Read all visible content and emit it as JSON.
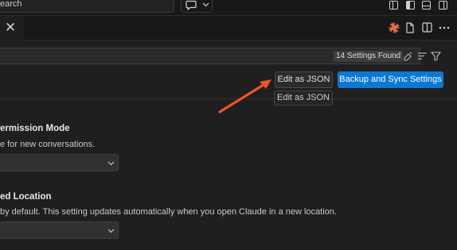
{
  "titlebar": {
    "search_text": "earch",
    "chat_icon": "comment-sparkle-icon",
    "layout_icons": [
      "layout-editor-icon",
      "toggle-sidebar-icon",
      "toggle-panel-icon",
      "toggle-secondary-sidebar-icon"
    ]
  },
  "tabbar": {
    "close_glyph": "✕",
    "actions": [
      "claude-asterisk-icon",
      "open-file-icon",
      "split-editor-icon",
      "more-actions-icon"
    ]
  },
  "settings_search": {
    "found_label": "14 Settings Found",
    "actions": [
      "clear-icon",
      "filter-list-icon",
      "filter-icon"
    ]
  },
  "buttons": {
    "edit_json_label": "Edit as JSON",
    "backup_sync_label": "Backup and Sync Settings",
    "tooltip": "Edit as JSON"
  },
  "settings": [
    {
      "title": "ermission Mode",
      "description": "e for new conversations."
    },
    {
      "title": "ed Location",
      "description": "by default. This setting updates automatically when you open Claude in a new location."
    }
  ],
  "colors": {
    "accent": "#0a78d4",
    "arrow": "#f0522b",
    "claude_icon": "#e8704a"
  }
}
